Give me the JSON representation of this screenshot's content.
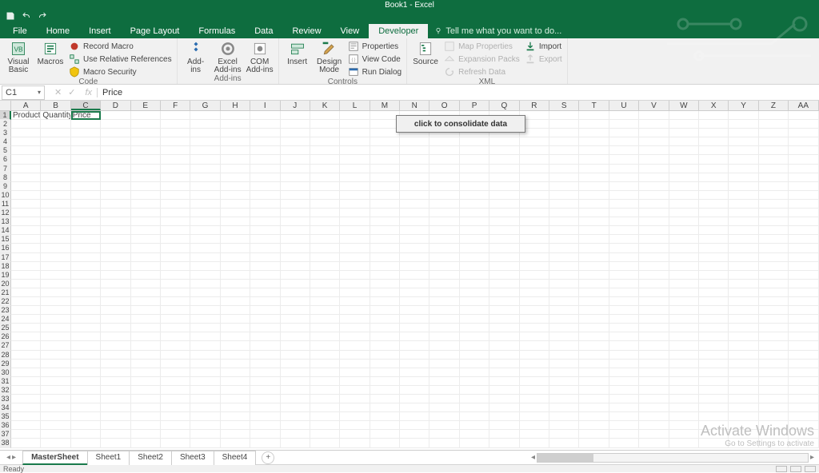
{
  "app": {
    "title": "Book1 - Excel"
  },
  "tabs": [
    "File",
    "Home",
    "Insert",
    "Page Layout",
    "Formulas",
    "Data",
    "Review",
    "View",
    "Developer"
  ],
  "active_tab": 8,
  "tell_me": "Tell me what you want to do...",
  "ribbon": {
    "code": {
      "visual_basic": "Visual\nBasic",
      "macros": "Macros",
      "record_macro": "Record Macro",
      "use_relative": "Use Relative References",
      "macro_security": "Macro Security",
      "label": "Code"
    },
    "addins": {
      "addins": "Add-\nins",
      "excel_addins": "Excel\nAdd-ins",
      "com_addins": "COM\nAdd-ins",
      "label": "Add-ins"
    },
    "controls": {
      "insert": "Insert",
      "design_mode": "Design\nMode",
      "properties": "Properties",
      "view_code": "View Code",
      "run_dialog": "Run Dialog",
      "label": "Controls"
    },
    "xml": {
      "source": "Source",
      "map_properties": "Map Properties",
      "expansion_packs": "Expansion Packs",
      "refresh_data": "Refresh Data",
      "import": "Import",
      "export": "Export",
      "label": "XML"
    }
  },
  "namebox": "C1",
  "formula_value": "Price",
  "columns": [
    "A",
    "B",
    "C",
    "D",
    "E",
    "F",
    "G",
    "H",
    "I",
    "J",
    "K",
    "L",
    "M",
    "N",
    "O",
    "P",
    "Q",
    "R",
    "S",
    "T",
    "U",
    "V",
    "W",
    "X",
    "Y",
    "Z",
    "AA"
  ],
  "selected_col_index": 2,
  "rows_count": 38,
  "selected_row_index": 0,
  "cells": {
    "A1": "Product",
    "B1": "Quantity",
    "C1": "Price"
  },
  "embedded_button": "click to  consolidate data",
  "sheets": [
    "MasterSheet",
    "Sheet1",
    "Sheet2",
    "Sheet3",
    "Sheet4"
  ],
  "active_sheet": 0,
  "status_left": "Ready",
  "watermark": {
    "l1": "Activate Windows",
    "l2": "Go to Settings to activate"
  }
}
